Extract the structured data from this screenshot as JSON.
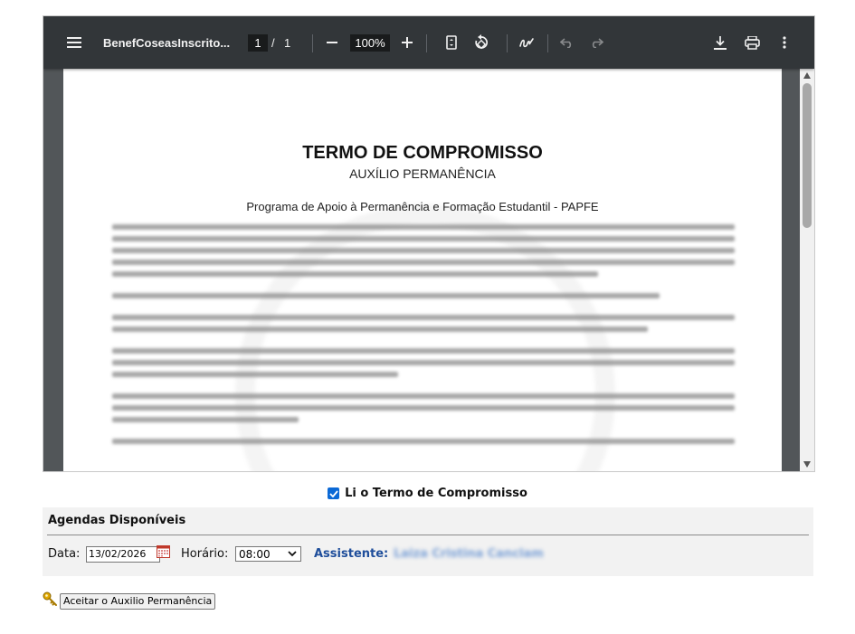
{
  "viewer": {
    "filename": "BenefCoseasInscrito...",
    "page_current": "1",
    "page_separator": "/",
    "page_total": "1",
    "zoom": "100%",
    "icons": [
      "menu-icon",
      "zoom-out-icon",
      "zoom-in-icon",
      "fit-page-icon",
      "rotate-icon",
      "draw-icon",
      "undo-icon",
      "redo-icon",
      "download-icon",
      "print-icon",
      "more-icon"
    ]
  },
  "document": {
    "heading": "TERMO DE COMPROMISSO",
    "subheading": "AUXÍLIO PERMANÊNCIA",
    "program": "Programa de Apoio à Permanência e Formação Estudantil - PAPFE"
  },
  "form": {
    "confirm_label": "Li o Termo de Compromisso",
    "confirm_checked": true,
    "agendas_title": "Agendas Disponíveis",
    "date_label": "Data:",
    "date_value": "13/02/2026",
    "time_label": "Horário:",
    "time_value": "08:00",
    "assistant_label": "Assistente:",
    "assistant_name": "Laiza Cristina Canclam",
    "accept_button": "Aceitar o Auxilio Permanência"
  },
  "colors": {
    "toolbar": "#323639",
    "viewer_bg": "#525659",
    "checkbox": "#0b69d6",
    "assistant_label": "#1f4e9b",
    "panel_bg": "#f2f2f2"
  }
}
